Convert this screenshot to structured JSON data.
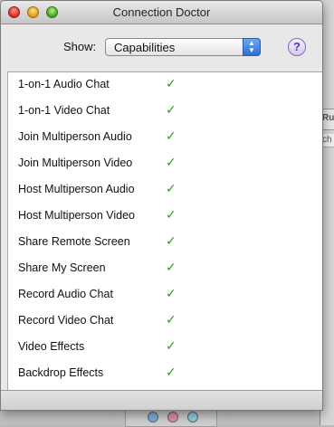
{
  "window": {
    "title": "Connection Doctor"
  },
  "toolbar": {
    "show_label": "Show:",
    "show_value": "Capabilities",
    "stepper_glyph": "▲▼",
    "help_glyph": "?"
  },
  "capabilities": [
    {
      "label": "1-on-1 Audio Chat",
      "status": "✓"
    },
    {
      "label": "1-on-1 Video Chat",
      "status": "✓"
    },
    {
      "label": "Join Multiperson Audio",
      "status": "✓"
    },
    {
      "label": "Join Multiperson Video",
      "status": "✓"
    },
    {
      "label": "Host Multiperson Audio",
      "status": "✓"
    },
    {
      "label": "Host Multiperson Video",
      "status": "✓"
    },
    {
      "label": "Share Remote Screen",
      "status": "✓"
    },
    {
      "label": "Share My Screen",
      "status": "✓"
    },
    {
      "label": "Record Audio Chat",
      "status": "✓"
    },
    {
      "label": "Record Video Chat",
      "status": "✓"
    },
    {
      "label": "Video Effects",
      "status": "✓"
    },
    {
      "label": "Backdrop Effects",
      "status": "✓"
    }
  ],
  "background": {
    "right_text_1": "Ru",
    "right_text_2": "ch ▾"
  },
  "colors": {
    "check": "#2e9b22",
    "close": "#d8261b",
    "minimize": "#d99b12",
    "zoom": "#3f9e1f",
    "popup_accent": "#2a6fd6"
  }
}
